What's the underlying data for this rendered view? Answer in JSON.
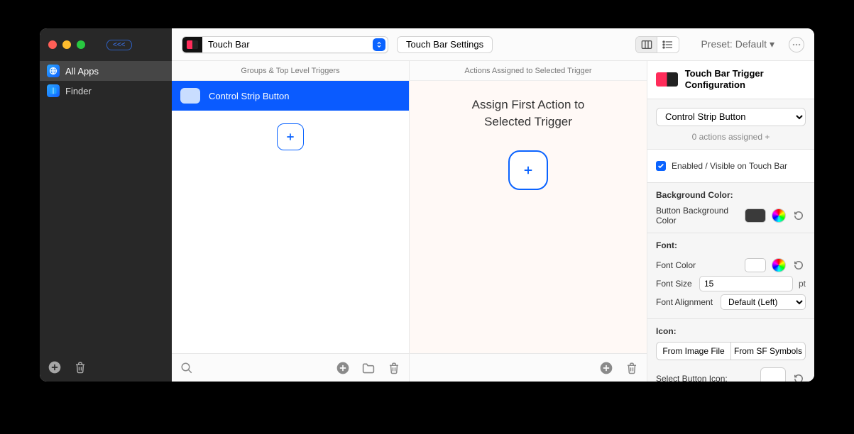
{
  "sidebar": {
    "back_label": "<<<",
    "items": [
      {
        "label": "All Apps"
      },
      {
        "label": "Finder"
      }
    ]
  },
  "toolbar": {
    "category_value": "Touch Bar",
    "settings_button": "Touch Bar Settings",
    "preset_label": "Preset: Default ▾"
  },
  "columns": {
    "groups_header": "Groups & Top Level Triggers",
    "actions_header": "Actions Assigned to Selected Trigger",
    "trigger_row_label": "Control Strip Button",
    "assign_title_1": "Assign First Action to",
    "assign_title_2": "Selected Trigger"
  },
  "inspector": {
    "title": "Touch Bar Trigger Configuration",
    "type_select_value": "Control Strip Button",
    "actions_assigned_text": "0 actions assigned +",
    "enabled_label": "Enabled / Visible on Touch Bar",
    "bg_section": "Background Color:",
    "bg_row_label": "Button Background Color",
    "font_section": "Font:",
    "font_color_label": "Font Color",
    "font_size_label": "Font Size",
    "font_size_value": "15",
    "font_size_unit": "pt",
    "font_align_label": "Font Alignment",
    "font_align_value": "Default (Left)",
    "icon_section": "Icon:",
    "seg_image": "From Image File",
    "seg_sf": "From SF Symbols",
    "select_icon_label": "Select Button Icon:"
  }
}
